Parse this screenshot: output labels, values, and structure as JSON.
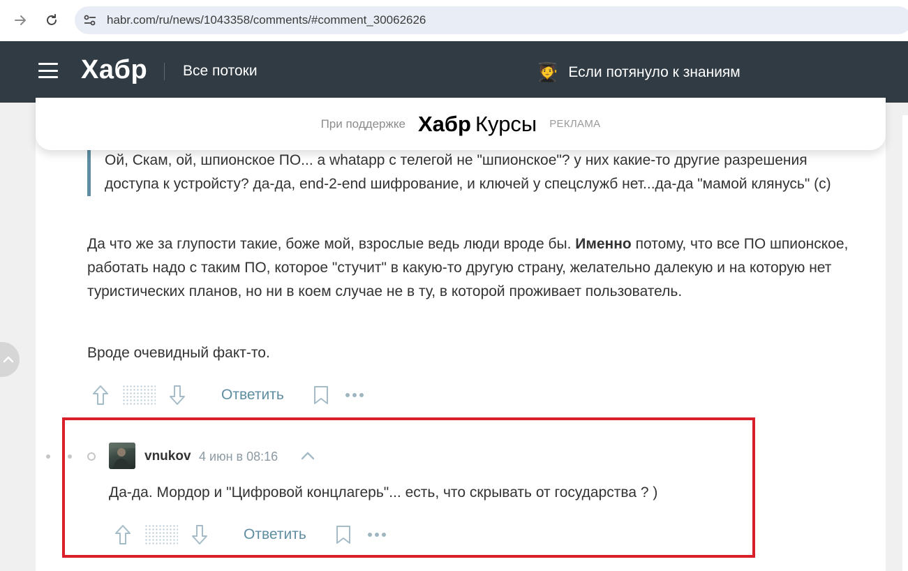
{
  "browser": {
    "back_icon": "arrow-right-icon",
    "reload_icon": "reload-icon",
    "site_settings_icon": "tune-icon",
    "url": "habr.com/ru/news/1043358/comments/#comment_30062626"
  },
  "header": {
    "logo": "Хабр",
    "nav_label": "Все потоки",
    "promo_emoji": "🧑‍🎓",
    "promo_text": "Если потянуло к знаниям"
  },
  "sponsor": {
    "label": "При поддержке",
    "brand": "Хабр",
    "product": "Курсы",
    "ad_label": "РЕКЛАМА"
  },
  "comment_parent": {
    "quote": "Ой, Скам, ой, шпионское ПО... а whatapp с телегой не \"шпионское\"? у них какие-то другие разрешения доступа к устройсту? да-да, end-2-end шифрование, и ключей у спецслужб нет...да-да \"мамой клянусь\" (с)",
    "para1_before": "Да что же за глупости такие, боже мой, взрослые ведь люди вроде бы. ",
    "para1_bold": "Именно",
    "para1_after": " потому, что все ПО шпионское, работать надо с таким ПО, которое \"стучит\" в какую-то другую страну, желательно далекую и на которую нет туристических планов, но ни в коем случае не в ту, в которой проживает пользователь.",
    "para2": "Вроде очевидный факт-то.",
    "reply_label": "Ответить"
  },
  "comment_reply": {
    "username": "vnukov",
    "timestamp": "4 июн в 08:16",
    "text": "Да-да. Мордор и \"Цифровой концлагерь\"... есть, что скрывать от государства ? )",
    "reply_label": "Ответить"
  },
  "colors": {
    "header_bg": "#303b44",
    "accent": "#5e8da1",
    "highlight": "#d9202a"
  }
}
